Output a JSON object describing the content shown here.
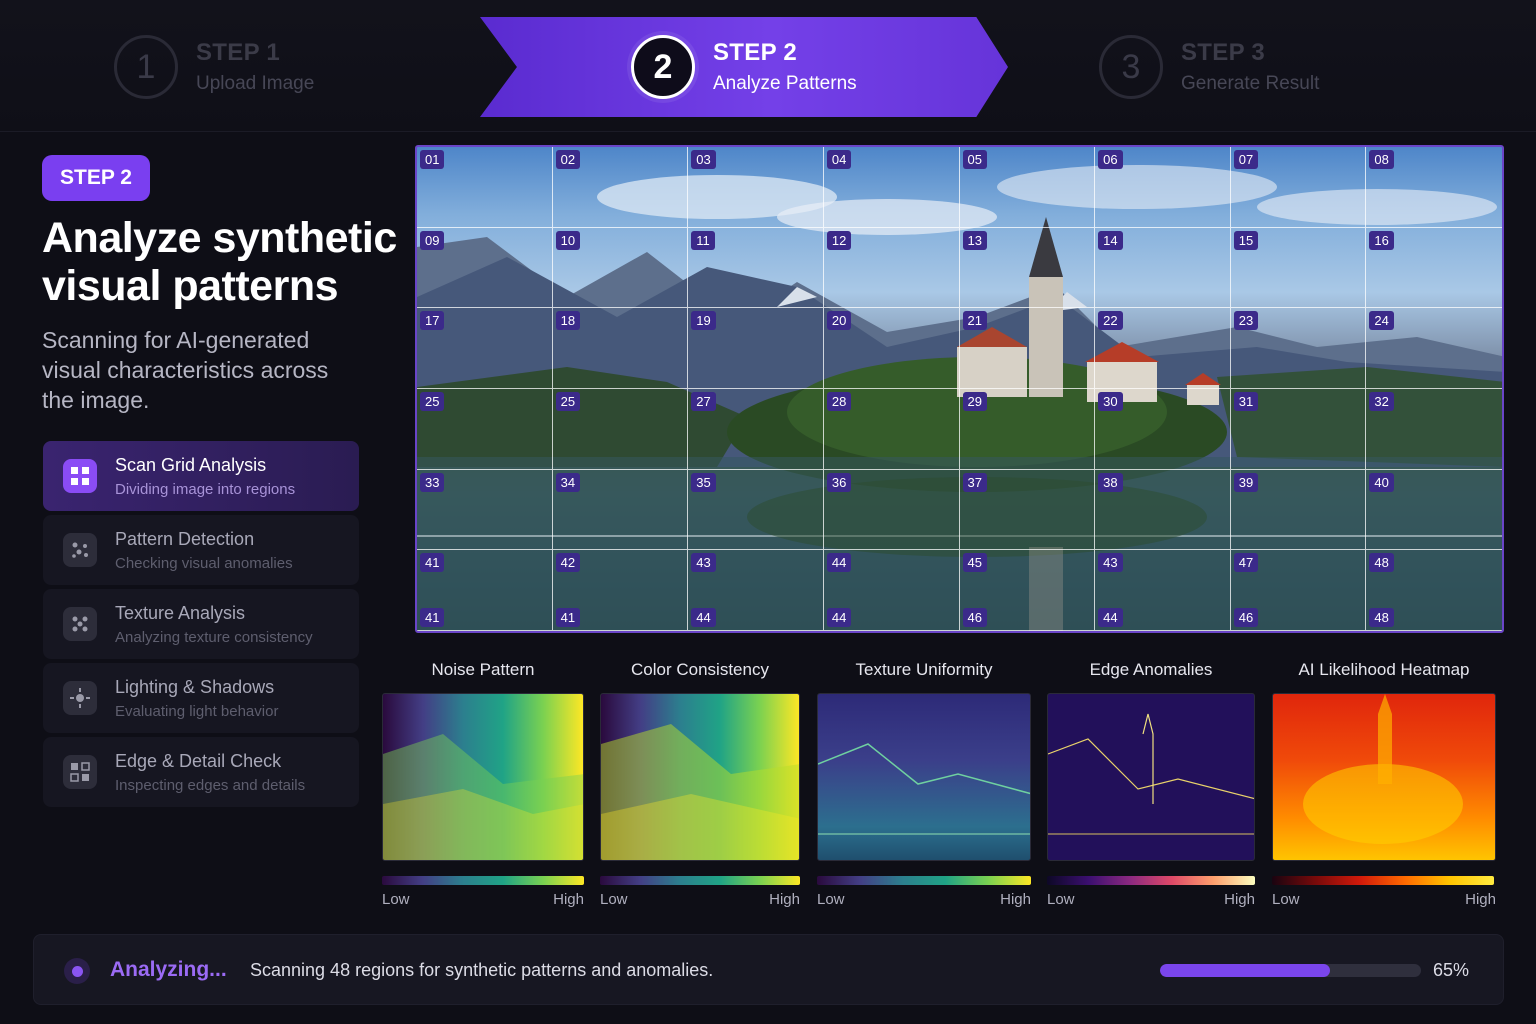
{
  "stepper": {
    "steps": [
      {
        "num": "1",
        "title": "STEP 1",
        "subtitle": "Upload Image"
      },
      {
        "num": "2",
        "title": "STEP 2",
        "subtitle": "Analyze Patterns"
      },
      {
        "num": "3",
        "title": "STEP 3",
        "subtitle": "Generate Result"
      }
    ]
  },
  "panel": {
    "badge": "STEP 2",
    "headline": "Analyze synthetic visual patterns",
    "description": "Scanning for AI-generated visual characteristics across the image.",
    "tasks": [
      {
        "name": "Scan Grid Analysis",
        "sub": "Dividing image into regions",
        "icon": "grid-scan-icon"
      },
      {
        "name": "Pattern Detection",
        "sub": "Checking visual anomalies",
        "icon": "pattern-icon"
      },
      {
        "name": "Texture Analysis",
        "sub": "Analyzing texture consistency",
        "icon": "texture-icon"
      },
      {
        "name": "Lighting & Shadows",
        "sub": "Evaluating light behavior",
        "icon": "lighting-icon"
      },
      {
        "name": "Edge & Detail Check",
        "sub": "Inspecting edges and details",
        "icon": "edge-icon"
      }
    ]
  },
  "scan_grid": {
    "labels": [
      "01",
      "02",
      "03",
      "04",
      "05",
      "06",
      "07",
      "08",
      "09",
      "10",
      "11",
      "12",
      "13",
      "14",
      "15",
      "16",
      "17",
      "18",
      "19",
      "20",
      "21",
      "22",
      "23",
      "24",
      "25",
      "25",
      "27",
      "28",
      "29",
      "30",
      "31",
      "32",
      "33",
      "34",
      "35",
      "36",
      "37",
      "38",
      "39",
      "40",
      "41",
      "42",
      "43",
      "44",
      "45",
      "43",
      "47",
      "48"
    ],
    "bottom_labels": [
      "41",
      "41",
      "44",
      "44",
      "46",
      "44",
      "46",
      "48"
    ]
  },
  "maps": [
    {
      "title": "Noise Pattern",
      "low": "Low",
      "high": "High"
    },
    {
      "title": "Color Consistency",
      "low": "Low",
      "high": "High"
    },
    {
      "title": "Texture Uniformity",
      "low": "Low",
      "high": "High"
    },
    {
      "title": "Edge Anomalies",
      "low": "Low",
      "high": "High"
    },
    {
      "title": "AI Likelihood Heatmap",
      "low": "Low",
      "high": "High"
    }
  ],
  "status": {
    "label": "Analyzing...",
    "message": "Scanning 48 regions for synthetic patterns and anomalies.",
    "progress": 0.65,
    "percent": "65%"
  },
  "colors": {
    "accent": "#7a3ff0",
    "background": "#0e0e16"
  }
}
